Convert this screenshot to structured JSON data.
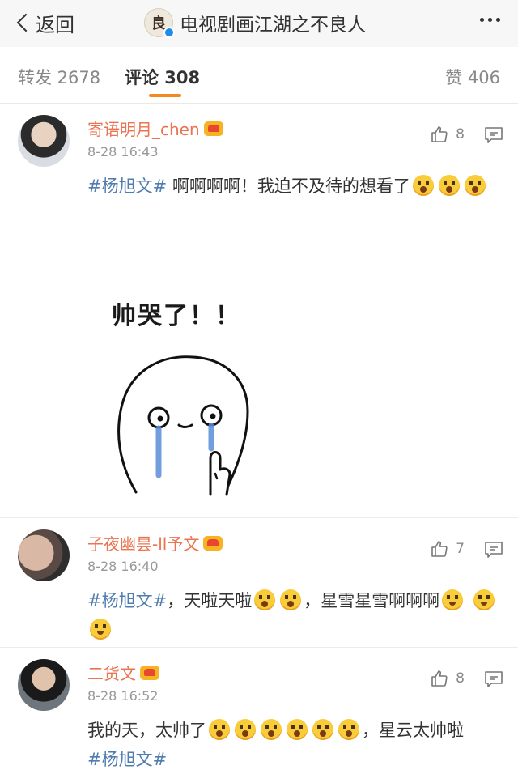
{
  "header": {
    "back_label": "返回",
    "title": "电视剧画江湖之不良人",
    "logo_char": "良"
  },
  "tabs": {
    "forward": "转发 2678",
    "comments": "评论 308",
    "likes": "赞 406"
  },
  "comments": [
    {
      "user": "寄语明月_chen",
      "time": "8-28 16:43",
      "likes": "8",
      "topic": "#杨旭文#",
      "text": "啊啊啊啊！我迫不及待的想看了",
      "sticker_text": "帅哭了！！"
    },
    {
      "user": "子夜幽昙-ll予文",
      "time": "8-28 16:40",
      "likes": "7",
      "topic": "#杨旭文#",
      "text_a": "，天啦天啦",
      "text_b": "，星雪星雪啊啊啊"
    },
    {
      "user": "二货文",
      "time": "8-28 16:52",
      "likes": "8",
      "text_a": "我的天，太帅了",
      "text_b": "，星云太帅啦",
      "topic": "#杨旭文#"
    }
  ],
  "colors": {
    "username": "#eb7350",
    "topic": "#507daf",
    "tab_indicator": "#f28b1f"
  }
}
